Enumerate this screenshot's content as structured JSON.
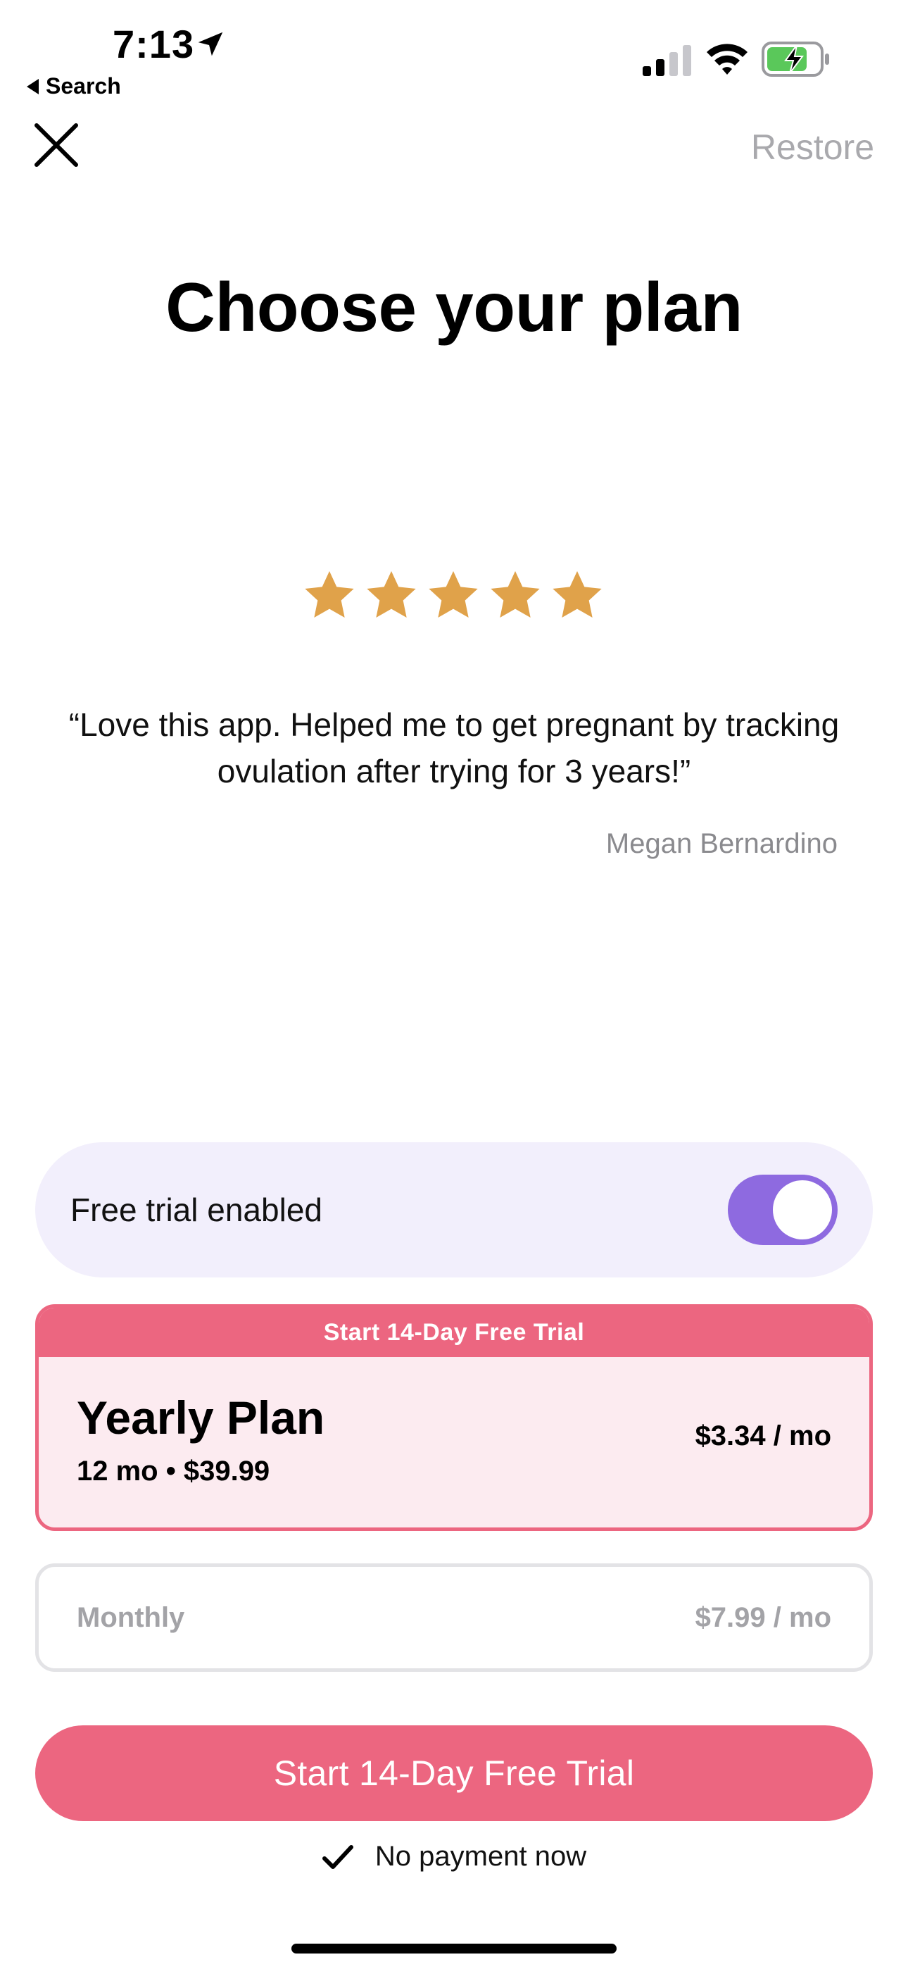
{
  "status_bar": {
    "time": "7:13",
    "back_label": "Search",
    "battery_color": "#5ac85a"
  },
  "nav": {
    "restore_label": "Restore"
  },
  "title": "Choose your plan",
  "review": {
    "stars": 5,
    "star_color": "#e0a24a",
    "quote": "“Love this app. Helped me to get pregnant by tracking ovulation after trying for 3 years!”",
    "author": "Megan Bernardino"
  },
  "free_trial": {
    "label": "Free trial enabled",
    "enabled": true,
    "toggle_color": "#8e6ae0"
  },
  "plans": {
    "yearly": {
      "banner": "Start 14-Day Free Trial",
      "name": "Yearly Plan",
      "subtitle": "12 mo • $39.99",
      "price": "$3.34 / mo",
      "selected": true
    },
    "monthly": {
      "name": "Monthly",
      "price": "$7.99 / mo",
      "selected": false
    }
  },
  "cta": {
    "label": "Start 14-Day Free Trial",
    "color": "#ec6680"
  },
  "footer": {
    "no_payment": "No payment now"
  }
}
